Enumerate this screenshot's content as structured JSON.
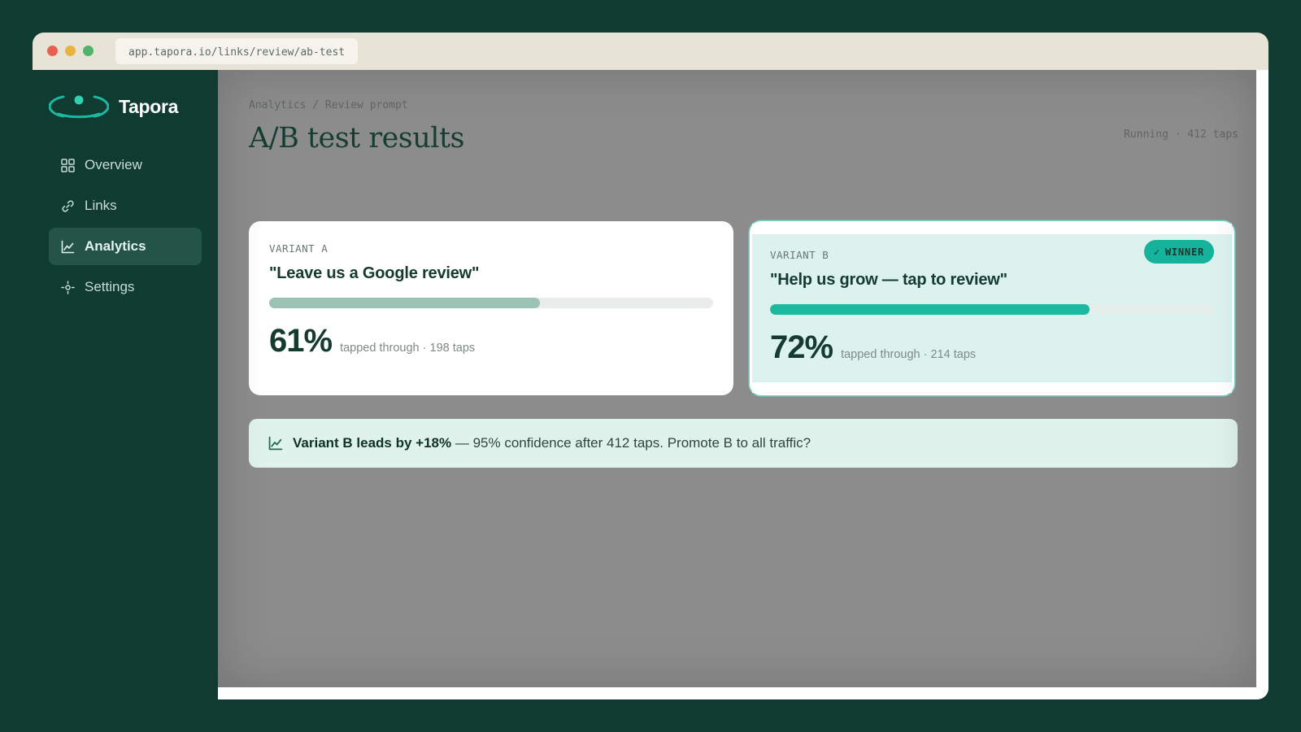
{
  "browser": {
    "url": "app.tapora.io/links/review/ab-test"
  },
  "brand": {
    "name": "Tapora",
    "accent": "#1db8a0"
  },
  "sidebar": {
    "items": [
      {
        "label": "Overview",
        "icon": "grid-icon",
        "active": false
      },
      {
        "label": "Links",
        "icon": "link-icon",
        "active": false
      },
      {
        "label": "Analytics",
        "icon": "chart-line-icon",
        "active": true
      },
      {
        "label": "Settings",
        "icon": "gear-icon",
        "active": false
      }
    ]
  },
  "header": {
    "breadcrumb": "Analytics / Review prompt",
    "title": "A/B test results",
    "status": "Running · 412 taps"
  },
  "variants": [
    {
      "label": "VARIANT A",
      "quote": "\"Leave us a Google review\"",
      "percent_value": 61,
      "percent_text": "61%",
      "detail": "tapped through · 198 taps",
      "winner": false
    },
    {
      "label": "VARIANT B",
      "quote": "\"Help us grow — tap to review\"",
      "percent_value": 72,
      "percent_text": "72%",
      "detail": "tapped through · 214 taps",
      "winner": true,
      "winner_label": "WINNER",
      "winner_check": "✓"
    }
  ],
  "banner": {
    "icon": "chart-line-icon",
    "strong": "Variant B leads by +18%",
    "text": " — 95% confidence after 412 taps. Promote B to all traffic?"
  }
}
